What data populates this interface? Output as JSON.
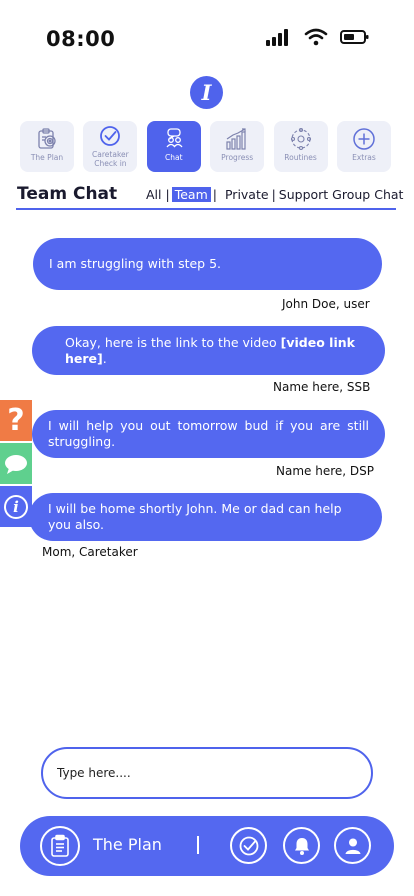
{
  "status": {
    "time": "08:00"
  },
  "logo": {
    "letter": "I"
  },
  "nav": {
    "tiles": [
      {
        "label": "The Plan",
        "icon": "clipboard-target-icon"
      },
      {
        "label": "Caretaker Check in",
        "icon": "check-circle-icon"
      },
      {
        "label": "Chat",
        "icon": "chat-people-icon"
      },
      {
        "label": "Progress",
        "icon": "bar-chart-icon"
      },
      {
        "label": "Routines",
        "icon": "routine-cycle-icon"
      },
      {
        "label": "Extras",
        "icon": "plus-circle-icon"
      }
    ],
    "active_index": 2
  },
  "chat": {
    "title": "Team Chat",
    "filters": {
      "all": "All",
      "team": "Team",
      "private": "Private",
      "support": "Support Group Chat",
      "separator": "|"
    },
    "messages": [
      {
        "text": "I am struggling with step 5.",
        "sender": "John Doe, user"
      },
      {
        "text": "Okay, here is the link to the video ",
        "link": "[video link here]",
        "suffix": ".",
        "sender": "Name here, SSB"
      },
      {
        "text": "I will help you out tomorrow bud if you are still struggling.",
        "sender": "Name here, DSP"
      },
      {
        "text": "I will be home shortly John. Me or dad can help you also.",
        "sender": "Mom, Caretaker"
      }
    ]
  },
  "side_tabs": [
    {
      "icon": "question-mark-icon",
      "glyph": "?",
      "color": "#f07b45"
    },
    {
      "icon": "speech-bubble-icon",
      "color": "#5fd08e"
    },
    {
      "icon": "info-icon",
      "glyph": "i",
      "color": "#5468f0"
    }
  ],
  "input": {
    "placeholder": "Type here...."
  },
  "bottom_bar": {
    "label": "The Plan",
    "divider": "|",
    "icons": [
      "clipboard-icon",
      "check-circle-icon",
      "bell-icon",
      "user-icon"
    ]
  },
  "colors": {
    "accent": "#5468f0",
    "tile_bg": "#eef0f8",
    "orange": "#f07b45",
    "green": "#5fd08e"
  }
}
